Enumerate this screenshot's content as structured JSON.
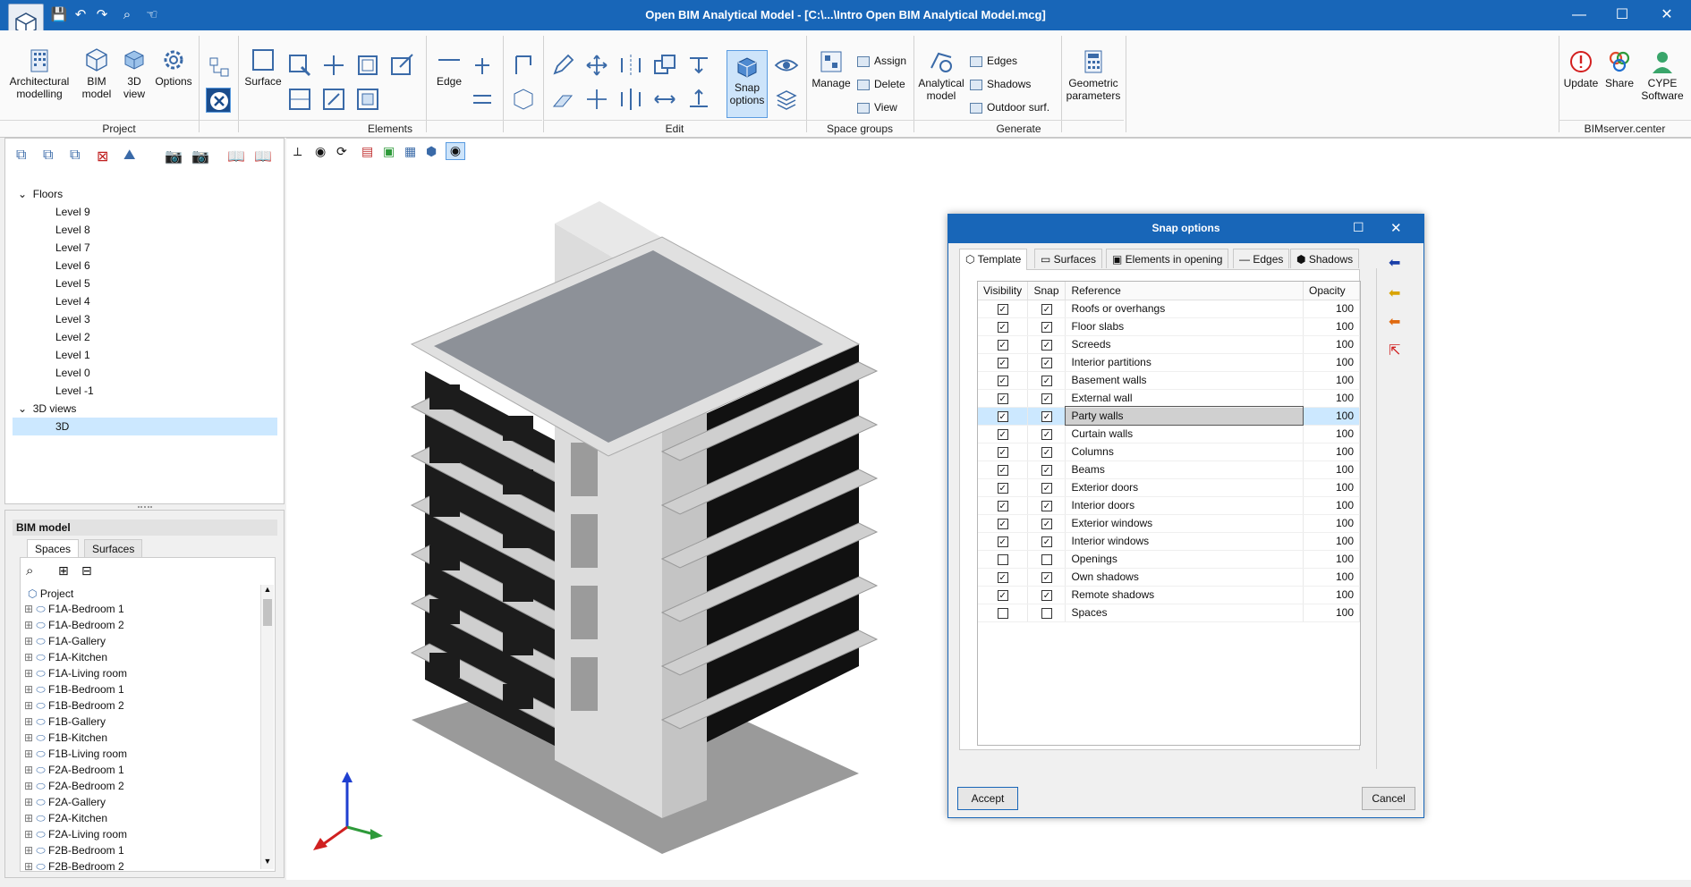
{
  "window": {
    "title": "Open BIM Analytical Model - [C:\\...\\Intro Open BIM Analytical Model.mcg]",
    "min": "—",
    "max": "☐",
    "close": "✕"
  },
  "ribbon": {
    "project": {
      "label": "Project",
      "buttons": [
        "Architectural modelling",
        "BIM model",
        "3D view",
        "Options"
      ]
    },
    "elements": {
      "label": "Elements",
      "surface": "Surface",
      "edge": "Edge"
    },
    "edit": {
      "label": "Edit",
      "snap": "Snap options"
    },
    "space_groups": {
      "label": "Space groups",
      "manage": "Manage",
      "assign": "Assign",
      "delete": "Delete",
      "view": "View"
    },
    "generate": {
      "label": "Generate",
      "analytical": "Analytical model",
      "edges": "Edges",
      "shadows": "Shadows",
      "outdoor": "Outdoor surf.",
      "geometric": "Geometric parameters"
    },
    "bimserver": {
      "label": "BIMserver.center",
      "update": "Update",
      "share": "Share",
      "cype": "CYPE Software"
    }
  },
  "views_tree": {
    "floors_label": "Floors",
    "floors": [
      "Level 9",
      "Level 8",
      "Level 7",
      "Level 6",
      "Level 5",
      "Level 4",
      "Level 3",
      "Level 2",
      "Level 1",
      "Level 0",
      "Level -1"
    ],
    "views3d_label": "3D views",
    "views3d": [
      "3D"
    ]
  },
  "bim_panel": {
    "title": "BIM model",
    "tabs": [
      "Spaces",
      "Surfaces"
    ],
    "root": "Project",
    "items": [
      "F1A-Bedroom 1",
      "F1A-Bedroom 2",
      "F1A-Gallery",
      "F1A-Kitchen",
      "F1A-Living room",
      "F1B-Bedroom 1",
      "F1B-Bedroom 2",
      "F1B-Gallery",
      "F1B-Kitchen",
      "F1B-Living room",
      "F2A-Bedroom 1",
      "F2A-Bedroom 2",
      "F2A-Gallery",
      "F2A-Kitchen",
      "F2A-Living room",
      "F2B-Bedroom 1",
      "F2B-Bedroom 2"
    ]
  },
  "dialog": {
    "title": "Snap options",
    "tabs": [
      "Template",
      "Surfaces",
      "Elements in opening",
      "Edges",
      "Shadows"
    ],
    "columns": [
      "Visibility",
      "Snap",
      "Reference",
      "Opacity"
    ],
    "rows": [
      {
        "vis": true,
        "snap": true,
        "ref": "Roofs or overhangs",
        "op": "100"
      },
      {
        "vis": true,
        "snap": true,
        "ref": "Floor slabs",
        "op": "100"
      },
      {
        "vis": true,
        "snap": true,
        "ref": "Screeds",
        "op": "100"
      },
      {
        "vis": true,
        "snap": true,
        "ref": "Interior partitions",
        "op": "100"
      },
      {
        "vis": true,
        "snap": true,
        "ref": "Basement walls",
        "op": "100"
      },
      {
        "vis": true,
        "snap": true,
        "ref": "External wall",
        "op": "100"
      },
      {
        "vis": true,
        "snap": true,
        "ref": "Party walls",
        "op": "100"
      },
      {
        "vis": true,
        "snap": true,
        "ref": "Curtain walls",
        "op": "100"
      },
      {
        "vis": true,
        "snap": true,
        "ref": "Columns",
        "op": "100"
      },
      {
        "vis": true,
        "snap": true,
        "ref": "Beams",
        "op": "100"
      },
      {
        "vis": true,
        "snap": true,
        "ref": "Exterior doors",
        "op": "100"
      },
      {
        "vis": true,
        "snap": true,
        "ref": "Interior doors",
        "op": "100"
      },
      {
        "vis": true,
        "snap": true,
        "ref": "Exterior windows",
        "op": "100"
      },
      {
        "vis": true,
        "snap": true,
        "ref": "Interior windows",
        "op": "100"
      },
      {
        "vis": false,
        "snap": false,
        "ref": "Openings",
        "op": "100"
      },
      {
        "vis": true,
        "snap": true,
        "ref": "Own shadows",
        "op": "100"
      },
      {
        "vis": true,
        "snap": true,
        "ref": "Remote shadows",
        "op": "100"
      },
      {
        "vis": false,
        "snap": false,
        "ref": "Spaces",
        "op": "100"
      }
    ],
    "accept": "Accept",
    "cancel": "Cancel"
  },
  "colors": {
    "accent": "#1866b8",
    "selection": "#cce8ff"
  }
}
